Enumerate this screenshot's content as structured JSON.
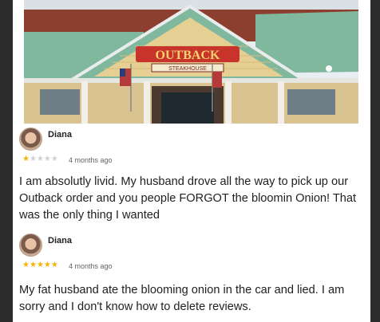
{
  "photo": {
    "sign_brand": "OUTBACK",
    "sign_sub": "STEAKHOUSE"
  },
  "reviews": [
    {
      "name": "Diana",
      "rating": 1,
      "max_rating": 5,
      "time": "4 months ago",
      "text": "I am absolutly livid. My husband drove all the way to pick up our Outback order and you people FORGOT the bloomin Onion! That was the only thing I wanted"
    },
    {
      "name": "Diana",
      "rating": 5,
      "max_rating": 5,
      "time": "4 months ago",
      "text": "My fat husband ate the blooming onion in the car and lied. I am sorry and I don't know how to delete reviews."
    }
  ],
  "colors": {
    "star_on": "#f4b400",
    "star_off": "#d0d0d0",
    "roof": "#7fb89c",
    "brand": "#c8342c"
  }
}
